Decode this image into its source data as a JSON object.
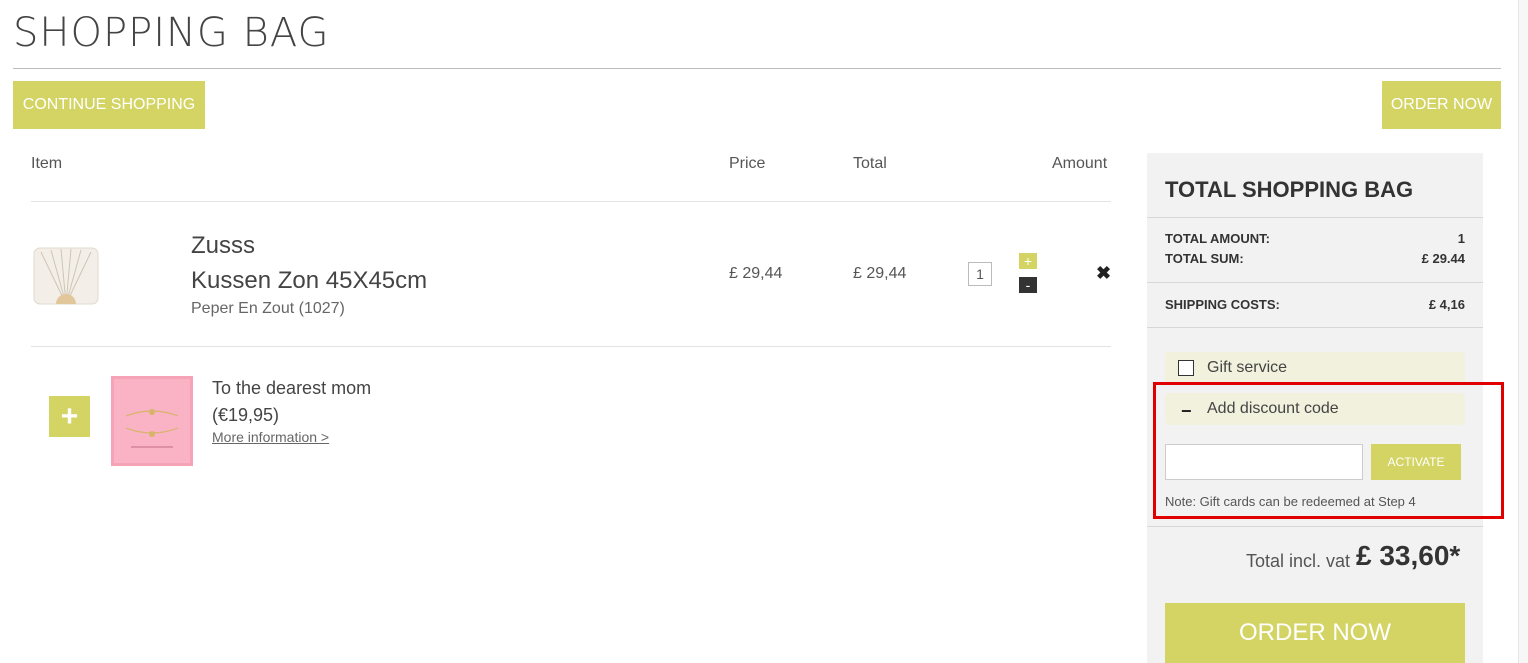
{
  "page": {
    "title": "SHOPPING BAG"
  },
  "buttons": {
    "continue": "CONTINUE SHOPPING",
    "order_top": "ORDER NOW",
    "order_bottom": "ORDER NOW",
    "activate": "ACTIVATE"
  },
  "table": {
    "headers": {
      "item": "Item",
      "price": "Price",
      "total": "Total",
      "amount": "Amount"
    }
  },
  "cart_item": {
    "brand": "Zusss",
    "name": "Kussen Zon 45X45cm",
    "variant": "Peper En Zout (1027)",
    "price": "£ 29,44",
    "total": "£ 29,44",
    "quantity": "1",
    "qty_plus": "+",
    "qty_minus": "-",
    "remove": "✖"
  },
  "upsell": {
    "add": "+",
    "title": "To the dearest mom (€19,95)",
    "link": "More information >"
  },
  "summary": {
    "title": "TOTAL SHOPPING BAG",
    "rows": [
      {
        "label": "TOTAL AMOUNT:",
        "value": "1"
      },
      {
        "label": "TOTAL SUM:",
        "value": "£ 29.44"
      },
      {
        "label": "SHIPPING COSTS:",
        "value": "£ 4,16"
      }
    ],
    "gift_service": "Gift service",
    "discount_toggle": "−",
    "discount_label": "Add discount code",
    "discount_value": "",
    "gift_note": "Note: Gift cards can be redeemed at Step 4",
    "total_label": "Total incl. vat",
    "total_value": "£ 33,60*"
  },
  "colors": {
    "accent": "#d3d464",
    "highlight": "#e00000"
  }
}
